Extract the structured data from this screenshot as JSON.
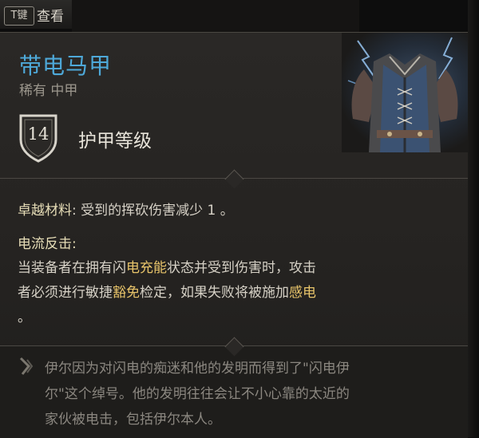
{
  "header": {
    "key_badge": "T键",
    "inspect_label": "查看"
  },
  "item": {
    "name": "带电马甲",
    "rarity_type": "稀有 中甲",
    "armor_class_value": "14",
    "armor_class_label": "护甲等级"
  },
  "properties": {
    "superior_label": "卓越材料",
    "superior_text": ": 受到的挥砍伤害减少 1 。",
    "ability_title": "电流反击:",
    "ability_line1_a": "当装备者在拥有闪",
    "ability_line1_hl": "电充能",
    "ability_line1_b": "状态并受到伤害时，攻击",
    "ability_line2_a": "者必须进行敏捷",
    "ability_line2_hl1": "豁免",
    "ability_line2_b": "检定，如果失败将被施加",
    "ability_line2_hl2": "感电",
    "ability_line3": "。"
  },
  "lore": {
    "line1": "伊尔因为对闪电的痴迷和他的发明而得到了\"闪电伊",
    "line2": "尔\"这个绰号。他的发明往往会让不小心靠的太近的",
    "line3": "家伙被电击，包括伊尔本人。"
  },
  "colors": {
    "title": "#4ea9d9",
    "highlight": "#e8c46a",
    "text": "#d6d1c6",
    "lore_text": "#8b8780"
  }
}
